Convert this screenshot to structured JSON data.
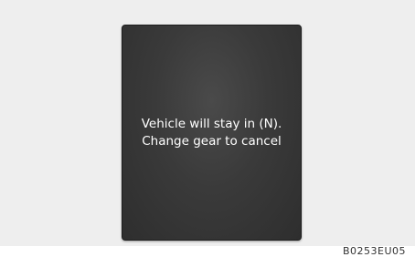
{
  "display": {
    "message_line1": "Vehicle will stay in (N).",
    "message_line2": "Change gear to cancel"
  },
  "figure_code": "B0253EU05",
  "colors": {
    "background": "#eeeeee",
    "display_bg": "#3a3a3a",
    "text": "#ffffff"
  }
}
